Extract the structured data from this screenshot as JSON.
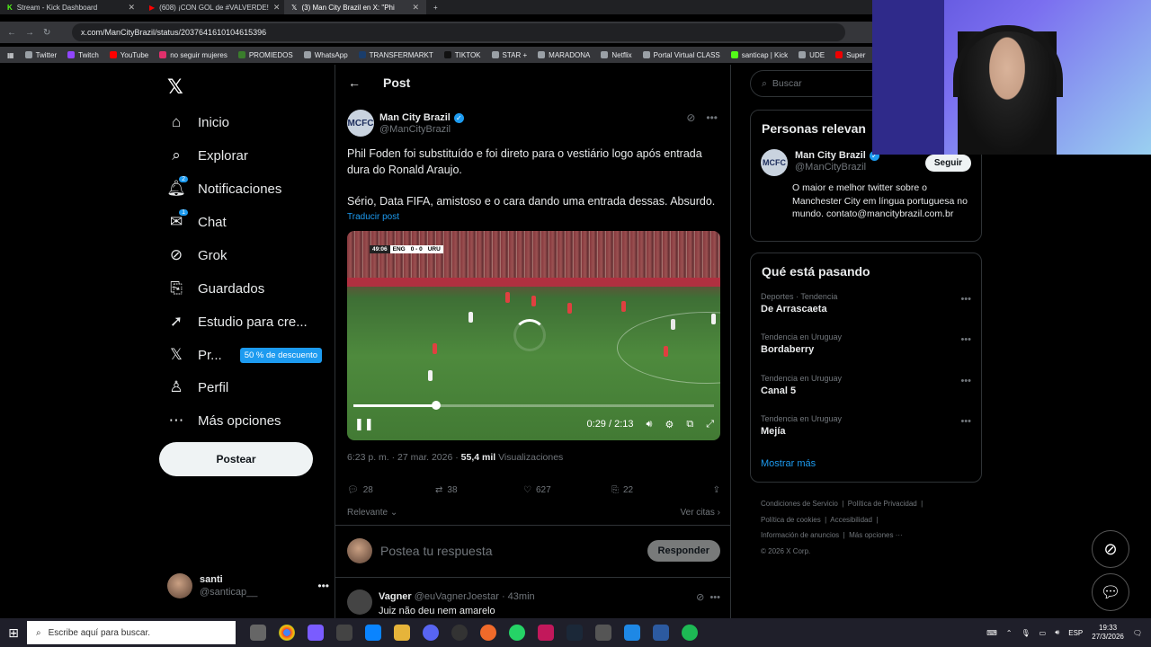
{
  "browser": {
    "tabs": [
      {
        "label": "Stream - Kick Dashboard",
        "active": false
      },
      {
        "label": "(608) ¡CON GOL de #VALVERDE!",
        "active": false
      },
      {
        "label": "(3) Man City Brazil en X: \"Phi",
        "active": true
      }
    ],
    "url": "x.com/ManCityBrazil/status/2037641610104615396",
    "bookmarks": [
      "Twitter",
      "Twitch",
      "YouTube",
      "no seguir mujeres",
      "PROMIEDOS",
      "WhatsApp",
      "TRANSFERMARKT",
      "TIKTOK",
      "STAR +",
      "MARADONA",
      "Netflix",
      "Portal Virtual CLASS",
      "santicap | Kick",
      "UDE",
      "Super"
    ]
  },
  "nav": {
    "items": [
      {
        "label": "Inicio",
        "icon": "home-icon"
      },
      {
        "label": "Explorar",
        "icon": "search-icon"
      },
      {
        "label": "Notificaciones",
        "icon": "bell-icon",
        "badge": "2"
      },
      {
        "label": "Chat",
        "icon": "mail-icon",
        "badge": "1"
      },
      {
        "label": "Grok",
        "icon": "grok-icon"
      },
      {
        "label": "Guardados",
        "icon": "bookmark-icon"
      },
      {
        "label": "Estudio para cre...",
        "icon": "rocket-icon"
      },
      {
        "label": "Pr...",
        "icon": "x-premium-icon",
        "promo": "50 % de descuento"
      },
      {
        "label": "Perfil",
        "icon": "person-icon"
      },
      {
        "label": "Más opciones",
        "icon": "more-circle-icon"
      }
    ],
    "post_button": "Postear",
    "account": {
      "name": "santi",
      "handle": "@santicap__"
    }
  },
  "post": {
    "header": "Post",
    "author_name": "Man City Brazil",
    "author_handle": "@ManCityBrazil",
    "text_1": "Phil Foden foi substituído e foi direto para o vestiário logo após entrada dura do Ronald Araujo.",
    "text_2": "Sério, Data FIFA, amistoso e o cara dando uma entrada dessas. Absurdo.",
    "translate": "Traducir post",
    "video": {
      "scoreboard": {
        "clock": "49:06",
        "home": "ENG",
        "score": "0 - 0",
        "away": "URU"
      },
      "time": "0:29 / 2:13",
      "progress": 0.23
    },
    "time_meta": "6:23 p. m. · 27 mar. 2026 ·",
    "views_count": "55,4 mil",
    "views_label": "Visualizaciones",
    "replies": "28",
    "reposts": "38",
    "likes": "627",
    "bookmarks": "22",
    "sort": "Relevante",
    "quotes": "Ver citas",
    "reply_placeholder": "Postea tu respuesta",
    "reply_button": "Responder"
  },
  "comment": {
    "name": "Vagner",
    "handle": "@euVagnerJoestar",
    "time": "· 43min",
    "text": "Juiz não deu nem amarelo"
  },
  "sidebar": {
    "search_placeholder": "Buscar",
    "relevant_title": "Personas relevan",
    "rel_name": "Man City Brazil",
    "rel_handle": "@ManCityBrazil",
    "follow": "Seguir",
    "bio": "O maior e melhor twitter sobre o Manchester City em língua portuguesa no mundo. contato@mancitybrazil.com.br",
    "trending_title": "Qué está pasando",
    "trends": [
      {
        "meta": "Deportes · Tendencia",
        "name": "De Arrascaeta"
      },
      {
        "meta": "Tendencia en Uruguay",
        "name": "Bordaberry"
      },
      {
        "meta": "Tendencia en Uruguay",
        "name": "Canal 5"
      },
      {
        "meta": "Tendencia en Uruguay",
        "name": "Mejía"
      }
    ],
    "show_more": "Mostrar más",
    "footer": [
      "Condiciones de Servicio",
      "Política de Privacidad",
      "Política de cookies",
      "Accesibilidad",
      "Información de anuncios",
      "Más opciones ···",
      "© 2026 X Corp."
    ]
  },
  "taskbar": {
    "search_placeholder": "Escribe aquí para buscar.",
    "lang": "ESP",
    "time": "19:33",
    "date": "27/3/2026"
  },
  "colors": {
    "accent": "#1d9bf0",
    "background": "#000000",
    "border": "#2f3336"
  }
}
